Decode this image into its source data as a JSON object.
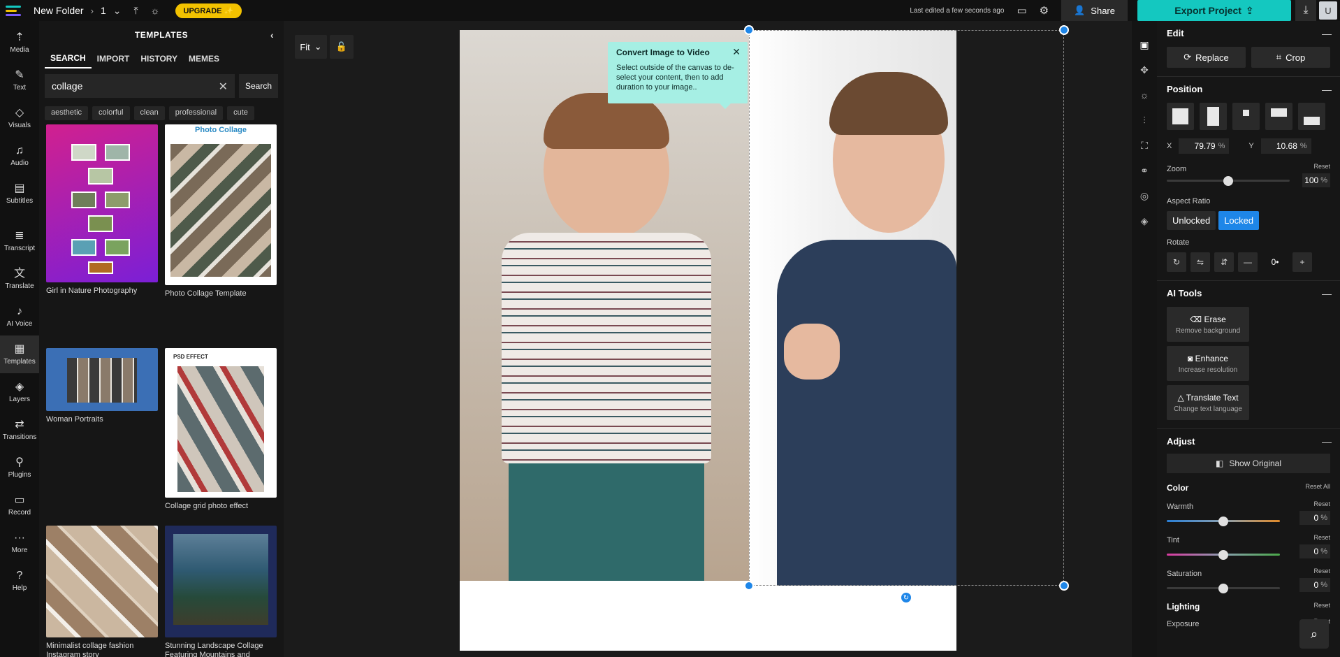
{
  "topbar": {
    "folder_name": "New Folder",
    "page_number": "1",
    "upgrade_label": "UPGRADE ✨",
    "last_edited": "Last edited a few seconds ago",
    "share_label": "Share",
    "export_label": "Export Project",
    "avatar_initial": "U"
  },
  "rail": {
    "items": [
      {
        "label": "Media",
        "icon": "media-icon"
      },
      {
        "label": "Text",
        "icon": "text-icon"
      },
      {
        "label": "Visuals",
        "icon": "visuals-icon"
      },
      {
        "label": "Audio",
        "icon": "audio-icon"
      },
      {
        "label": "Subtitles",
        "icon": "subtitles-icon"
      },
      {
        "label": "Transcript",
        "icon": "transcript-icon"
      },
      {
        "label": "Translate",
        "icon": "translate-icon"
      },
      {
        "label": "AI Voice",
        "icon": "ai-voice-icon"
      },
      {
        "label": "Templates",
        "icon": "templates-icon"
      },
      {
        "label": "Layers",
        "icon": "layers-icon"
      },
      {
        "label": "Transitions",
        "icon": "transitions-icon"
      },
      {
        "label": "Plugins",
        "icon": "plugins-icon"
      },
      {
        "label": "Record",
        "icon": "record-icon"
      },
      {
        "label": "More",
        "icon": "more-icon"
      },
      {
        "label": "Help",
        "icon": "help-icon"
      }
    ],
    "active": "Templates"
  },
  "panel": {
    "title": "TEMPLATES",
    "tabs": [
      "SEARCH",
      "IMPORT",
      "HISTORY",
      "MEMES"
    ],
    "active_tab": "SEARCH",
    "search_value": "collage",
    "search_button": "Search",
    "chips": [
      "aesthetic",
      "colorful",
      "clean",
      "professional",
      "cute"
    ],
    "templates": [
      {
        "label": "Girl in Nature Photography"
      },
      {
        "label": "Photo Collage Template",
        "thumb_title": "Photo Collage"
      },
      {
        "label": "Woman Portraits"
      },
      {
        "label": "Collage grid photo effect",
        "thumb_title": "PSD EFFECT"
      },
      {
        "label": "Minimalist collage fashion Instagram story"
      },
      {
        "label": "Stunning Landscape Collage Featuring Mountains and"
      }
    ]
  },
  "stage": {
    "fit_label": "Fit",
    "tooltip_title": "Convert Image to Video",
    "tooltip_body": "Select outside of the canvas to de-select your content, then to add duration to your image.."
  },
  "props": {
    "edit": {
      "title": "Edit",
      "replace": "Replace",
      "crop": "Crop"
    },
    "position": {
      "title": "Position",
      "x_label": "X",
      "x_value": "79.79",
      "x_unit": "%",
      "y_label": "Y",
      "y_value": "10.68",
      "y_unit": "%",
      "zoom_label": "Zoom",
      "zoom_reset": "Reset",
      "zoom_value": "100",
      "zoom_unit": "%",
      "zoom_level": 0.5,
      "aspect_label": "Aspect Ratio",
      "unlocked": "Unlocked",
      "locked": "Locked",
      "rotate_label": "Rotate",
      "rotate_value": "0•"
    },
    "ai_tools": {
      "title": "AI Tools",
      "items": [
        {
          "title": "Erase",
          "sub": "Remove background"
        },
        {
          "title": "Enhance",
          "sub": "Increase resolution"
        },
        {
          "title": "Translate Text",
          "sub": "Change text language"
        }
      ]
    },
    "adjust": {
      "title": "Adjust",
      "show_original": "Show Original",
      "color_label": "Color",
      "reset_all": "Reset All",
      "sliders": [
        {
          "label": "Warmth",
          "reset": "Reset",
          "value": "0",
          "unit": "%",
          "level": 0.5
        },
        {
          "label": "Tint",
          "reset": "Reset",
          "value": "0",
          "unit": "%",
          "level": 0.5
        },
        {
          "label": "Saturation",
          "reset": "Reset",
          "value": "0",
          "unit": "%",
          "level": 0.5
        }
      ],
      "lighting_label": "Lighting",
      "lighting_reset": "Reset",
      "exposure_label": "Exposure",
      "exposure_reset": "Reset"
    }
  },
  "colors": {
    "accent": "#1e86e8",
    "export": "#14c8c0",
    "upgrade": "#f2c200",
    "tooltip": "#a6efe4"
  }
}
